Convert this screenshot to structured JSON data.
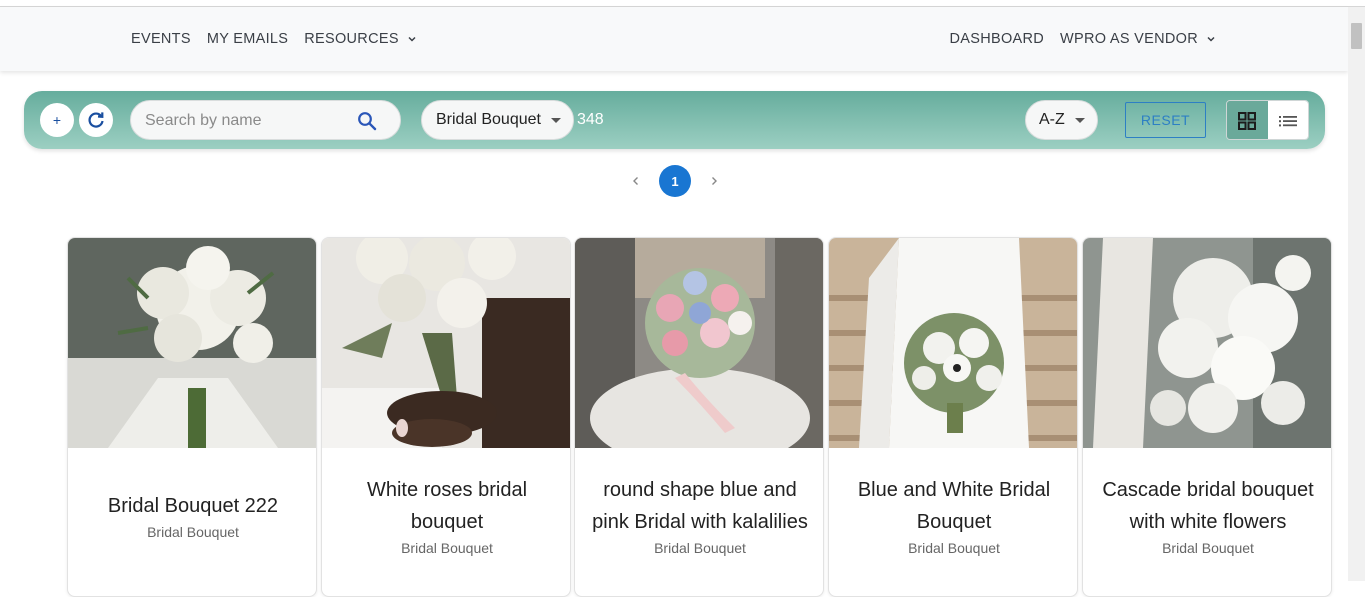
{
  "nav": {
    "left": [
      {
        "label": "EVENTS"
      },
      {
        "label": "MY EMAILS"
      },
      {
        "label": "RESOURCES"
      }
    ],
    "right": [
      {
        "label": "DASHBOARD"
      },
      {
        "label": "WPRO AS VENDOR"
      }
    ]
  },
  "toolbar": {
    "add_label": "+",
    "search_placeholder": "Search by name",
    "category_select": "Bridal Bouquet",
    "count": "348",
    "sort_select": "A-Z",
    "reset_label": "RESET"
  },
  "pagination": {
    "current_page": "1"
  },
  "cards": [
    {
      "title": "Bridal Bouquet 222",
      "category": "Bridal Bouquet"
    },
    {
      "title": "White roses bridal bouquet",
      "category": "Bridal Bouquet"
    },
    {
      "title": "round shape blue and pink Bridal with kalalilies",
      "category": "Bridal Bouquet"
    },
    {
      "title": "Blue and White Bridal Bouquet",
      "category": "Bridal Bouquet"
    },
    {
      "title": "Cascade bridal bouquet with white flowers",
      "category": "Bridal Bouquet"
    }
  ],
  "colors": {
    "toolbar_gradient_top": "#66ad9d",
    "toolbar_gradient_bottom": "#9ccfc2",
    "accent_blue": "#1976d2",
    "reset_blue": "#2d7fc4"
  }
}
